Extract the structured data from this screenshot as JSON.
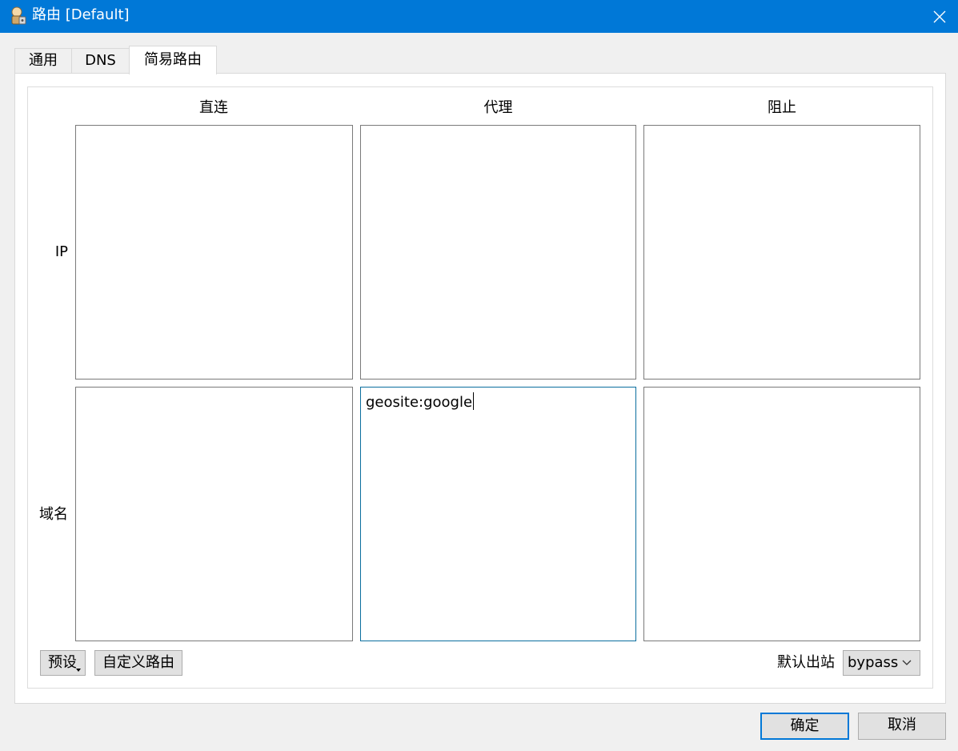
{
  "window": {
    "title": "路由 [Default]",
    "icon": "app-icon",
    "close_icon": "close-icon"
  },
  "tabs": [
    {
      "label": "通用"
    },
    {
      "label": "DNS"
    },
    {
      "label": "简易路由"
    }
  ],
  "simple_routing": {
    "columns": [
      "直连",
      "代理",
      "阻止"
    ],
    "rows": [
      "IP",
      "域名"
    ],
    "cells": {
      "ip_direct": "",
      "ip_proxy": "",
      "ip_block": "",
      "domain_direct": "",
      "domain_proxy": "geosite:google",
      "domain_block": ""
    },
    "preset_label": "预设",
    "custom_routing_label": "自定义路由",
    "default_outbound_label": "默认出站",
    "default_outbound_value": "bypass"
  },
  "footer": {
    "ok_label": "确定",
    "cancel_label": "取消"
  },
  "colors": {
    "titlebar": "#0078d7",
    "focus_border": "#0a6e9e"
  }
}
